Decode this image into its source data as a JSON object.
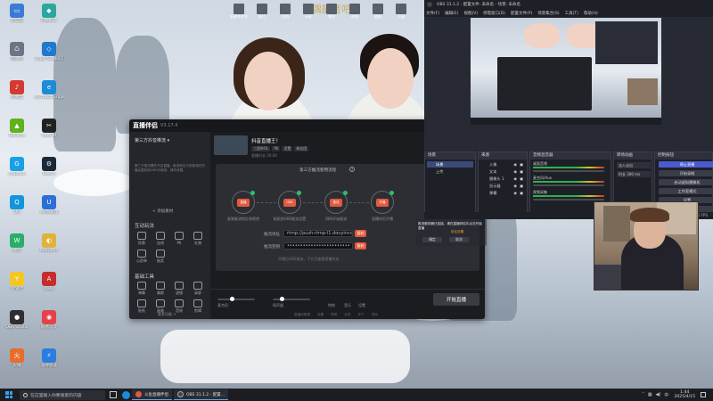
{
  "wallpaper": {
    "watermark": "偶韵音吧"
  },
  "desktop": {
    "icons": [
      {
        "label": "此电脑",
        "color": "#3b7bd6",
        "glyph": "▭"
      },
      {
        "label": "DeskGo",
        "color": "#2aa8a0",
        "glyph": "◆"
      },
      {
        "label": "回收站",
        "color": "#6c7686",
        "glyph": "♺"
      },
      {
        "label": "Visual Studio Code",
        "color": "#1f7acc",
        "glyph": "◇"
      },
      {
        "label": "网易云",
        "color": "#d33a31",
        "glyph": "♪"
      },
      {
        "label": "Microsoft Edge",
        "color": "#1c8bd8",
        "glyph": "e"
      },
      {
        "label": "GeForce",
        "color": "#5fb21f",
        "glyph": "▲"
      },
      {
        "label": "CapCut",
        "color": "#222",
        "glyph": "✂"
      },
      {
        "label": "Logitech",
        "color": "#1aa0e5",
        "glyph": "G"
      },
      {
        "label": "Steam",
        "color": "#1b2838",
        "glyph": "⚙"
      },
      {
        "label": "QQ",
        "color": "#1296db",
        "glyph": "Q"
      },
      {
        "label": "UU加速器",
        "color": "#2c6fd8",
        "glyph": "U"
      },
      {
        "label": "微信",
        "color": "#2aae67",
        "glyph": "W"
      },
      {
        "label": "WeGame",
        "color": "#e0b23a",
        "glyph": "◐"
      },
      {
        "label": "YY语音",
        "color": "#f3c623",
        "glyph": "Y"
      },
      {
        "label": "Apex",
        "color": "#c62d2d",
        "glyph": "A"
      },
      {
        "label": "OBS Studio",
        "color": "#302e31",
        "glyph": "●"
      },
      {
        "label": "网易游戏",
        "color": "#e3424a",
        "glyph": "◉"
      },
      {
        "label": "火绒",
        "color": "#e86c2a",
        "glyph": "火"
      },
      {
        "label": "雷神加速",
        "color": "#2b7de0",
        "glyph": "⚡"
      }
    ],
    "top_files": [
      "新建文件夹",
      "图片",
      "文档",
      "录屏",
      "素材",
      "视频",
      "截图",
      "下载"
    ]
  },
  "companion": {
    "logo": "直播伴侣",
    "version": "V3.17.4",
    "user": "第三方抖音推流 ▾",
    "notice": "第三方推流需先开启直播，推流地址与密钥请在开播后复制到OBS中使用，请勿泄露。",
    "add_scene": "+ 添加素材",
    "section_interact": "互动玩法",
    "interact_tools": [
      "投票",
      "连线",
      "PK",
      "礼物",
      "心愿单",
      "抽奖"
    ],
    "section_basic": "基础工具",
    "basic_tools": [
      "弹幕",
      "美颜",
      "滤镜",
      "录屏",
      "贴纸",
      "画笔",
      "音效",
      "剪辑"
    ],
    "more_tools": "更多功能 >",
    "room_title": "抖音直播王！",
    "room_tags": [
      "三国杀OL",
      "PK",
      "设置",
      "粉丝团"
    ],
    "room_stats": "直播时长 00:00",
    "top_btns": [
      "开播",
      "关播",
      "设置"
    ],
    "flow_title": "第三方推流使用流程",
    "flow_help": "?",
    "flow_link": "重置",
    "nodes": [
      {
        "core": "直播",
        "label": "复制推流地址和密钥"
      },
      {
        "core": "OBS",
        "label": "粘贴到OBS推流设置"
      },
      {
        "core": "推流",
        "label": "OBS开始推流"
      },
      {
        "core": "开播",
        "label": "直播伴侣开播"
      }
    ],
    "stream_label": "推流地址",
    "key_label": "推流密钥",
    "stream_value": "rtmp://push-rtmp-l1.douyincdn.com/thirdgame",
    "key_value": "••••••••••••••••••••••••",
    "copy": "复制",
    "hint": "开播后OBS推流，下方可查看直播状态",
    "bottom_labels": [
      "麦克风",
      "扬声器",
      "特效",
      "音乐",
      "设置"
    ],
    "start_btn": "开始直播",
    "footer": [
      "直播间管理",
      "设置",
      "帮助",
      "反馈",
      "关于",
      "官网"
    ]
  },
  "obs": {
    "title": "OBS 31.1.2 - 配置文件: 未命名 - 场景: 未命名",
    "menu": [
      "文件(F)",
      "编辑(E)",
      "视图(V)",
      "停靠窗口(D)",
      "配置文件(P)",
      "场景集合(S)",
      "工具(T)",
      "帮助(H)"
    ],
    "scenes_hdr": "场景",
    "scenes": [
      "场景",
      "上传"
    ],
    "sources_hdr": "来源",
    "sources": [
      "人像",
      "文本",
      "摄像头 1",
      "显示器",
      "弹幕"
    ],
    "mixer_hdr": "音频混音器",
    "mixer": [
      "桌面音频",
      "麦克风/Aux",
      "视频采集"
    ],
    "trans_hdr": "转场动画",
    "trans": [
      "淡入淡出",
      "时长 300 ms"
    ],
    "controls_hdr": "控制按钮",
    "controls": [
      "停止直播",
      "开始录制",
      "启动虚拟摄像机",
      "工作室模式",
      "设置",
      "退出"
    ],
    "status": "00:00:00  CPU 3.2%  60.00 / 60.00 FPS",
    "alert_text": "推流服务器已连接，请在直播伴侣中点击开始直播",
    "alert_link": "前往设置",
    "alert_btns": [
      "确定",
      "取消"
    ]
  },
  "taskbar": {
    "search_placeholder": "在这里输入你要搜索的内容",
    "items": [
      "斗鱼直播伴侣",
      "OBS 31.1.2 - 配置..."
    ],
    "time": "1:44",
    "date": "2025/4/15"
  }
}
